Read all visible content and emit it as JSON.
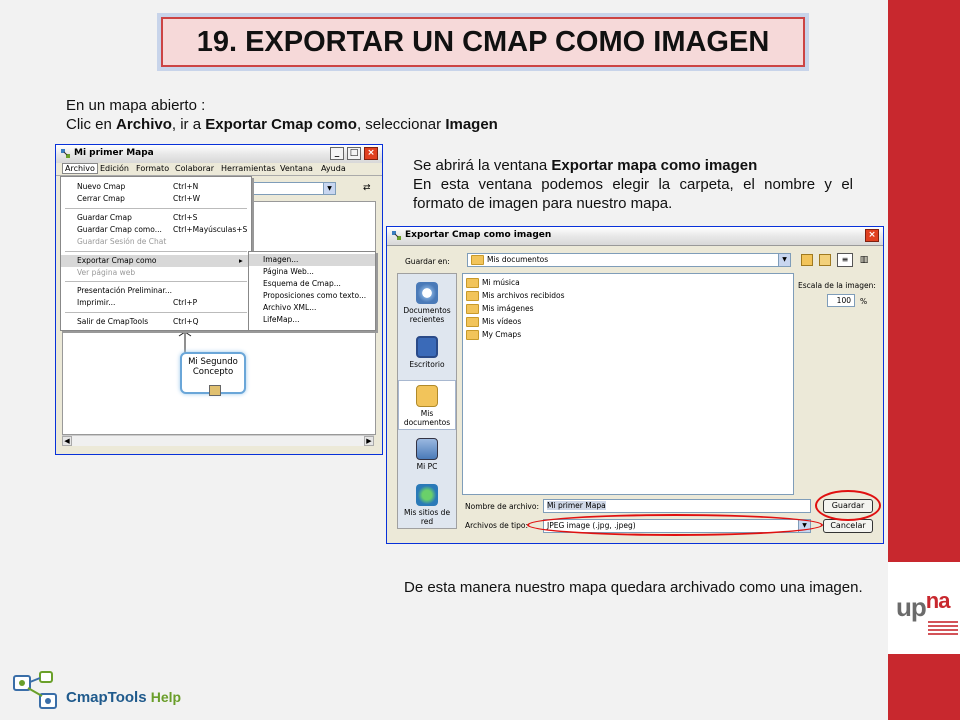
{
  "slide": {
    "title": "19. EXPORTAR UN CMAP COMO IMAGEN",
    "intro_line1": "En un mapa abierto :",
    "intro_line2_a": "Clic en ",
    "intro_line2_b": "Archivo",
    "intro_line2_c": ", ir a ",
    "intro_line2_d": "Exportar Cmap como",
    "intro_line2_e": ", seleccionar  ",
    "intro_line2_f": "Imagen",
    "right_p1_a": "Se abrirá la ventana ",
    "right_p1_b": "Exportar mapa como imagen",
    "right_p2": "En esta ventana podemos elegir la carpeta, el nombre y el formato de imagen para nuestro mapa.",
    "bottom_text": "De esta manera nuestro mapa quedara archivado como una imagen.",
    "brand_cmap": "CmapTools",
    "brand_help": "Help",
    "brand_upna_a": "up",
    "brand_upna_b": "na"
  },
  "cmap_window": {
    "title": "Mi primer Mapa",
    "menu": [
      "Archivo",
      "Edición",
      "Formato",
      "Colaborar",
      "Herramientas",
      "Ventana",
      "Ayuda"
    ],
    "file_menu": [
      {
        "label": "Nuevo Cmap",
        "shortcut": "Ctrl+N"
      },
      {
        "label": "Cerrar Cmap",
        "shortcut": "Ctrl+W"
      },
      {
        "label": "Guardar Cmap",
        "shortcut": "Ctrl+S"
      },
      {
        "label": "Guardar Cmap como...",
        "shortcut": "Ctrl+Mayúsculas+S"
      },
      {
        "label": "Guardar Sesión de Chat",
        "shortcut": ""
      },
      {
        "label": "Exportar Cmap como",
        "shortcut": "▸"
      },
      {
        "label": "Ver página web",
        "shortcut": ""
      },
      {
        "label": "Presentación Preliminar...",
        "shortcut": ""
      },
      {
        "label": "Imprimir...",
        "shortcut": "Ctrl+P"
      },
      {
        "label": "Salir de CmapTools",
        "shortcut": "Ctrl+Q"
      }
    ],
    "export_submenu": [
      "Imagen...",
      "Página Web...",
      "Esquema de Cmap...",
      "Proposiciones como texto...",
      "Archivo XML...",
      "LifeMap..."
    ],
    "concept_label": "Mi Segundo Concepto"
  },
  "export_dialog": {
    "title": "Exportar Cmap como imagen",
    "save_in_label": "Guardar en:",
    "save_in_value": "Mis documentos",
    "places": [
      "Documentos recientes",
      "Escritorio",
      "Mis documentos",
      "Mi PC",
      "Mis sitios de red"
    ],
    "files": [
      "Mi música",
      "Mis archivos recibidos",
      "Mis imágenes",
      "Mis vídeos",
      "My Cmaps"
    ],
    "scale_label": "Escala de la imagen:",
    "scale_value": "100",
    "scale_unit": "%",
    "filename_label": "Nombre de archivo:",
    "filename_value": "Mi primer Mapa",
    "filetype_label": "Archivos de tipo:",
    "filetype_value": "JPEG image (.jpg, .jpeg)",
    "save_button": "Guardar",
    "cancel_button": "Cancelar"
  },
  "colors": {
    "accent_red": "#c8282e",
    "highlight_ring": "#e01010",
    "title_bg": "#f6d9d9",
    "xp_face": "#ece9d8"
  }
}
